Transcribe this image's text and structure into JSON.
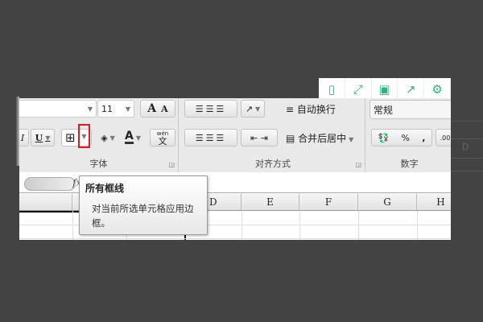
{
  "toolbar": [
    {
      "icon": "tablet-icon",
      "glyph": "▯"
    },
    {
      "icon": "fullscreen-icon",
      "glyph": "⤢"
    },
    {
      "icon": "save-icon",
      "glyph": "▣"
    },
    {
      "icon": "share-icon",
      "glyph": "↗"
    },
    {
      "icon": "gear-icon",
      "glyph": "⚙"
    }
  ],
  "accent": "#2db37d",
  "ribbon": {
    "font": {
      "size": "11",
      "grow": "A",
      "shrink": "A",
      "italic": "I",
      "underline": "U",
      "label": "字体",
      "phonetic": "wén",
      "phonetic_char": "文"
    },
    "align": {
      "wrap": "自动换行",
      "merge": "合并后居中",
      "label": "对齐方式"
    },
    "number": {
      "format": "常规",
      "percent": "%",
      "comma": ",",
      "decimal": ".00",
      "label": "数字"
    }
  },
  "formula": {
    "fx": "fx"
  },
  "columns": [
    "D",
    "E",
    "F",
    "G",
    "H"
  ],
  "tooltip": {
    "title": "所有框线",
    "body": "对当前所选单元格应用边框。"
  },
  "background": {
    "col": "D"
  }
}
